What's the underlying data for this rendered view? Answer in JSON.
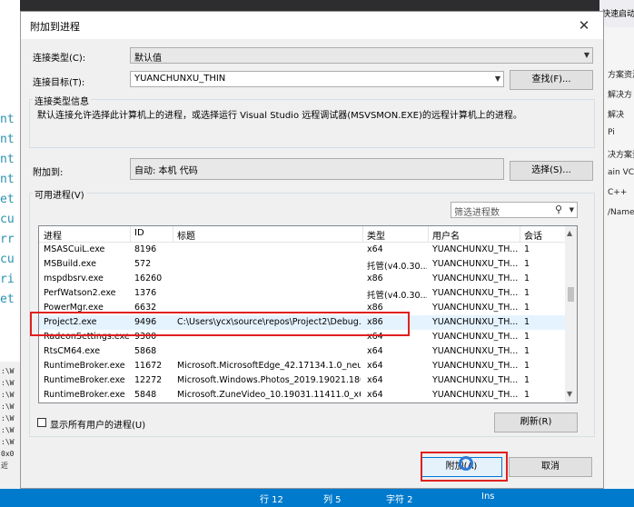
{
  "dialog": {
    "title": "附加到进程",
    "close_glyph": "✕",
    "connection_type_label": "连接类型(C):",
    "connection_type_value": "默认值",
    "connection_target_label": "连接目标(T):",
    "connection_target_value": "YUANCHUNXU_THIN",
    "find_button": "查找(F)...",
    "info_group_title": "连接类型信息",
    "info_text": "默认连接允许选择此计算机上的进程，或选择运行 Visual Studio 远程调试器(MSVSMON.EXE)的远程计算机上的进程。",
    "attach_to_label": "附加到:",
    "attach_to_value": "自动: 本机 代码",
    "select_button": "选择(S)...",
    "available_group_title": "可用进程(V)",
    "filter_placeholder": "筛选进程数",
    "columns": [
      "进程",
      "ID",
      "标题",
      "类型",
      "用户名",
      "会话"
    ],
    "processes": [
      {
        "name": "MSASCuiL.exe",
        "id": "8196",
        "title": "",
        "type": "x64",
        "user": "YUANCHUNXU_TH...",
        "session": "1"
      },
      {
        "name": "MSBuild.exe",
        "id": "572",
        "title": "",
        "type": "托管(v4.0.30...",
        "user": "YUANCHUNXU_TH...",
        "session": "1"
      },
      {
        "name": "mspdbsrv.exe",
        "id": "16260",
        "title": "",
        "type": "x86",
        "user": "YUANCHUNXU_TH...",
        "session": "1"
      },
      {
        "name": "PerfWatson2.exe",
        "id": "1376",
        "title": "",
        "type": "托管(v4.0.30...",
        "user": "YUANCHUNXU_TH...",
        "session": "1"
      },
      {
        "name": "PowerMgr.exe",
        "id": "6632",
        "title": "",
        "type": "x86",
        "user": "YUANCHUNXU_TH...",
        "session": "1"
      },
      {
        "name": "Project2.exe",
        "id": "9496",
        "title": "C:\\Users\\ycx\\source\\repos\\Project2\\Debug...",
        "type": "x86",
        "user": "YUANCHUNXU_TH...",
        "session": "1"
      },
      {
        "name": "RadeonSettings.exe",
        "id": "9300",
        "title": "",
        "type": "x64",
        "user": "YUANCHUNXU_TH...",
        "session": "1"
      },
      {
        "name": "RtsCM64.exe",
        "id": "5868",
        "title": "",
        "type": "x64",
        "user": "YUANCHUNXU_TH...",
        "session": "1"
      },
      {
        "name": "RuntimeBroker.exe",
        "id": "11672",
        "title": "Microsoft.MicrosoftEdge_42.17134.1.0_neut...",
        "type": "x64",
        "user": "YUANCHUNXU_TH...",
        "session": "1"
      },
      {
        "name": "RuntimeBroker.exe",
        "id": "12272",
        "title": "Microsoft.Windows.Photos_2019.19021.180...",
        "type": "x64",
        "user": "YUANCHUNXU_TH...",
        "session": "1"
      },
      {
        "name": "RuntimeBroker.exe",
        "id": "5848",
        "title": "Microsoft.ZuneVideo_10.19031.11411.0_x64...",
        "type": "x64",
        "user": "YUANCHUNXU_TH...",
        "session": "1"
      }
    ],
    "show_all_users_label": "显示所有用户的进程(U)",
    "refresh_button": "刷新(R)",
    "attach_button": "附加(A)",
    "cancel_button": "取消"
  },
  "statusbar": {
    "line": "行 12",
    "column": "列 5",
    "char": "字符 2",
    "mode": "Ins"
  },
  "ide": {
    "quick_launch": "快速启动 (Ctrl+",
    "right_panel_texts": [
      "方案资源",
      "解决方",
      "解决",
      "Pi",
      "决方案资",
      "ain VC",
      "C++",
      "/Name"
    ],
    "left_code": [
      "nt",
      "nt",
      "nt",
      "nt",
      "et",
      "cu",
      "rr",
      "cu",
      "ri",
      "et"
    ],
    "left_bottom_text": ":\\W :\\W :\\W :\\W :\\W :\\W :\\W 0x0 近"
  }
}
